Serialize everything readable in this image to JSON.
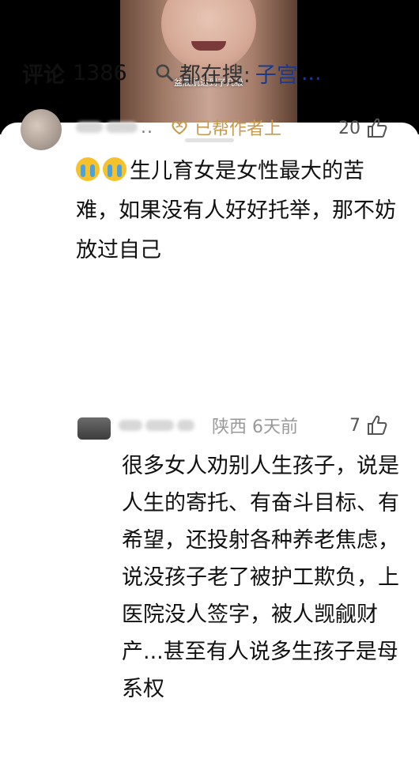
{
  "video": {
    "subtitle": "盆底肌达到了几级"
  },
  "comments_panel": {
    "title": "评论",
    "count": "1386",
    "search_label": "都在搜:",
    "search_term": "子宫",
    "search_ellipsis": "..."
  },
  "comments": [
    {
      "username_suffix": "..",
      "badge": "已帮作者上",
      "likes": "20",
      "text": "生儿育女是女性最大的苦难，如果没有人好好托举，那不妨放过自己",
      "emoji": [
        "crying-face",
        "crying-face"
      ]
    },
    {
      "location_time": "陕西 6天前",
      "likes": "7",
      "text": "很多女人劝别人生孩子，说是人生的寄托、有奋斗目标、有希望，还投射各种养老焦虑，说没孩子老了被护工欺负，上医院没人签字，被人觊觎财产...甚至有人说多生孩子是母系权"
    }
  ],
  "colors": {
    "badge": "#c69a4d",
    "search_term": "#1b3a8c",
    "meta_gray": "#999999"
  }
}
